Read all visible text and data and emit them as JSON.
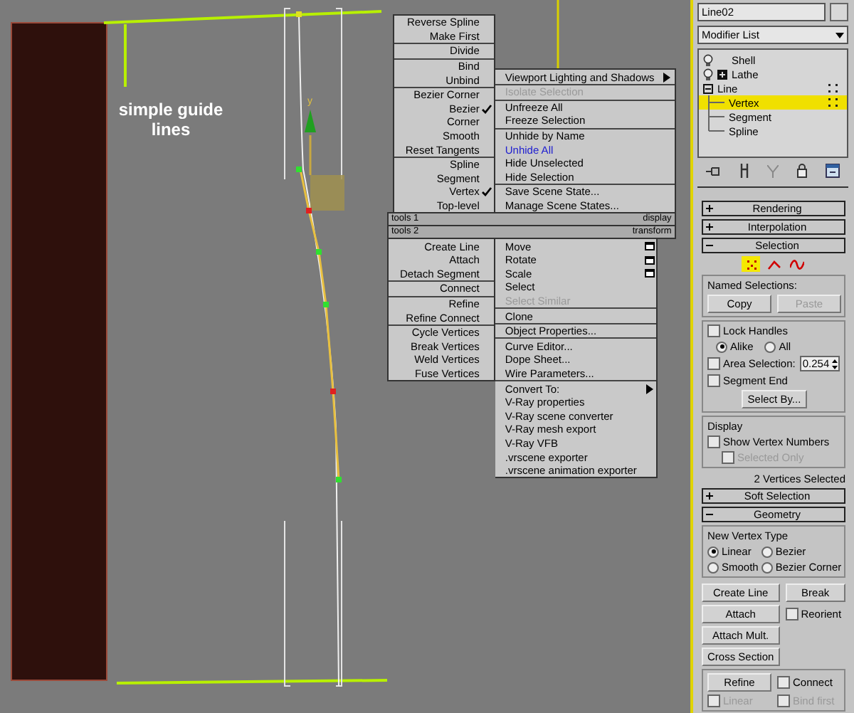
{
  "viewport": {
    "annotation": "simple guide lines",
    "gizmo_axis": "y"
  },
  "quad_menu": {
    "top_left": [
      [
        {
          "label": "Reverse Spline",
          "checked": false,
          "disabled": false
        },
        {
          "label": "Make First",
          "checked": false,
          "disabled": false
        }
      ],
      [
        {
          "label": "Divide",
          "checked": false,
          "disabled": false
        }
      ],
      [
        {
          "label": "Bind",
          "checked": false,
          "disabled": false
        },
        {
          "label": "Unbind",
          "checked": false,
          "disabled": false
        }
      ],
      [
        {
          "label": "Bezier Corner",
          "checked": false,
          "disabled": false
        },
        {
          "label": "Bezier",
          "checked": true,
          "disabled": false
        },
        {
          "label": "Corner",
          "checked": false,
          "disabled": false
        },
        {
          "label": "Smooth",
          "checked": false,
          "disabled": false
        },
        {
          "label": "Reset Tangents",
          "checked": false,
          "disabled": false
        }
      ],
      [
        {
          "label": "Spline",
          "checked": false,
          "disabled": false
        },
        {
          "label": "Segment",
          "checked": false,
          "disabled": false
        },
        {
          "label": "Vertex",
          "checked": true,
          "disabled": false
        },
        {
          "label": "Top-level",
          "checked": false,
          "disabled": false
        }
      ]
    ],
    "top_right": [
      [
        {
          "label": "Viewport Lighting and Shadows",
          "kind": "submenu",
          "disabled": false,
          "highlighted": false
        }
      ],
      [
        {
          "label": "Isolate Selection",
          "kind": "plain",
          "disabled": true,
          "highlighted": false
        }
      ],
      [
        {
          "label": "Unfreeze All",
          "kind": "plain",
          "disabled": false,
          "highlighted": false
        },
        {
          "label": "Freeze Selection",
          "kind": "plain",
          "disabled": false,
          "highlighted": false
        }
      ],
      [
        {
          "label": "Unhide by Name",
          "kind": "plain",
          "disabled": false,
          "highlighted": false
        },
        {
          "label": "Unhide All",
          "kind": "plain",
          "disabled": false,
          "highlighted": true
        },
        {
          "label": "Hide Unselected",
          "kind": "plain",
          "disabled": false,
          "highlighted": false
        },
        {
          "label": "Hide Selection",
          "kind": "plain",
          "disabled": false,
          "highlighted": false
        }
      ],
      [
        {
          "label": "Save Scene State...",
          "kind": "plain",
          "disabled": false,
          "highlighted": false
        },
        {
          "label": "Manage Scene States...",
          "kind": "plain",
          "disabled": false,
          "highlighted": false
        }
      ]
    ],
    "bar_1": {
      "left": "tools 1",
      "right": "display"
    },
    "bar_2": {
      "left": "tools 2",
      "right": "transform"
    },
    "bottom_left": [
      [
        {
          "label": "Create Line",
          "checked": false,
          "disabled": false
        },
        {
          "label": "Attach",
          "checked": false,
          "disabled": false
        },
        {
          "label": "Detach Segment",
          "checked": false,
          "disabled": false
        }
      ],
      [
        {
          "label": "Connect",
          "checked": false,
          "disabled": false
        }
      ],
      [
        {
          "label": "Refine",
          "checked": false,
          "disabled": false
        },
        {
          "label": "Refine Connect",
          "checked": false,
          "disabled": false
        }
      ],
      [
        {
          "label": "Cycle Vertices",
          "checked": false,
          "disabled": false
        },
        {
          "label": "Break Vertices",
          "checked": false,
          "disabled": false
        },
        {
          "label": "Weld Vertices",
          "checked": false,
          "disabled": false
        },
        {
          "label": "Fuse Vertices",
          "checked": false,
          "disabled": false
        }
      ]
    ],
    "bottom_right": [
      [
        {
          "label": "Move",
          "kind": "options",
          "disabled": false,
          "highlighted": false
        },
        {
          "label": "Rotate",
          "kind": "options",
          "disabled": false,
          "highlighted": false
        },
        {
          "label": "Scale",
          "kind": "options",
          "disabled": false,
          "highlighted": false
        },
        {
          "label": "Select",
          "kind": "plain",
          "disabled": false,
          "highlighted": false
        },
        {
          "label": "Select Similar",
          "kind": "plain",
          "disabled": true,
          "highlighted": false
        }
      ],
      [
        {
          "label": "Clone",
          "kind": "plain",
          "disabled": false,
          "highlighted": false
        }
      ],
      [
        {
          "label": "Object Properties...",
          "kind": "plain",
          "disabled": false,
          "highlighted": false
        }
      ],
      [
        {
          "label": "Curve Editor...",
          "kind": "plain",
          "disabled": false,
          "highlighted": false
        },
        {
          "label": "Dope Sheet...",
          "kind": "plain",
          "disabled": false,
          "highlighted": false
        },
        {
          "label": "Wire Parameters...",
          "kind": "plain",
          "disabled": false,
          "highlighted": false
        }
      ],
      [
        {
          "label": "Convert To:",
          "kind": "submenu",
          "disabled": false,
          "highlighted": false
        },
        {
          "label": "V-Ray properties",
          "kind": "plain",
          "disabled": false,
          "highlighted": false
        },
        {
          "label": "V-Ray scene converter",
          "kind": "plain",
          "disabled": false,
          "highlighted": false
        },
        {
          "label": "V-Ray mesh export",
          "kind": "plain",
          "disabled": false,
          "highlighted": false
        },
        {
          "label": "V-Ray VFB",
          "kind": "plain",
          "disabled": false,
          "highlighted": false
        },
        {
          "label": ".vrscene exporter",
          "kind": "plain",
          "disabled": false,
          "highlighted": false
        },
        {
          "label": ".vrscene animation exporter",
          "kind": "plain",
          "disabled": false,
          "highlighted": false
        }
      ]
    ]
  },
  "panel": {
    "object_name": "Line02",
    "modifier_list": "Modifier List",
    "stack": [
      {
        "label": "Shell",
        "kind": "modifier",
        "selected": false
      },
      {
        "label": "Lathe",
        "kind": "expandable_modifier",
        "expanded": false,
        "selected": false
      },
      {
        "label": "Line",
        "kind": "base_object",
        "expanded": true,
        "selected": false,
        "children": [
          {
            "label": "Vertex",
            "selected": true
          },
          {
            "label": "Segment",
            "selected": false
          },
          {
            "label": "Spline",
            "selected": false
          }
        ]
      }
    ],
    "rollouts": [
      {
        "title": "Rendering",
        "expanded": false
      },
      {
        "title": "Interpolation",
        "expanded": false
      },
      {
        "title": "Selection",
        "expanded": true,
        "selection": {
          "levels": [
            {
              "kind": "vertex",
              "selected": true
            },
            {
              "kind": "segment",
              "selected": false
            },
            {
              "kind": "spline",
              "selected": false
            }
          ],
          "named_title": "Named Selections:",
          "named_buttons": [
            {
              "label": "Copy",
              "disabled": false
            },
            {
              "label": "Paste",
              "disabled": true
            }
          ],
          "lock_handles": {
            "label": "Lock Handles",
            "checked": false,
            "disabled": false
          },
          "lock_mode": [
            {
              "label": "Alike",
              "selected": true
            },
            {
              "label": "All",
              "selected": false
            }
          ],
          "area_selection": {
            "label": "Area Selection:",
            "checked": false,
            "disabled": false,
            "value": "0.254"
          },
          "segment_end": {
            "label": "Segment End",
            "checked": false,
            "disabled": false
          },
          "select_by": "Select By...",
          "display_title": "Display",
          "show_vertex_numbers": {
            "label": "Show Vertex Numbers",
            "checked": false,
            "disabled": false
          },
          "selected_only": {
            "label": "Selected Only",
            "checked": false,
            "disabled": true
          },
          "status": "2 Vertices Selected"
        }
      },
      {
        "title": "Soft Selection",
        "expanded": false
      },
      {
        "title": "Geometry",
        "expanded": true,
        "geometry": {
          "vertex_type_title": "New Vertex Type",
          "vertex_types": [
            {
              "label": "Linear",
              "selected": true
            },
            {
              "label": "Bezier",
              "selected": false
            },
            {
              "label": "Smooth",
              "selected": false
            },
            {
              "label": "Bezier Corner",
              "selected": false
            }
          ],
          "create_line": "Create Line",
          "break": "Break",
          "attach": "Attach",
          "attach_mult": "Attach Mult.",
          "cross_section": "Cross Section",
          "refine": "Refine",
          "reorient": {
            "label": "Reorient",
            "checked": false,
            "disabled": false
          },
          "connect": {
            "label": "Connect",
            "checked": false,
            "disabled": false
          },
          "linear": {
            "label": "Linear",
            "checked": false,
            "disabled": true
          },
          "bind_first": {
            "label": "Bind first",
            "checked": false,
            "disabled": true
          }
        }
      }
    ]
  }
}
